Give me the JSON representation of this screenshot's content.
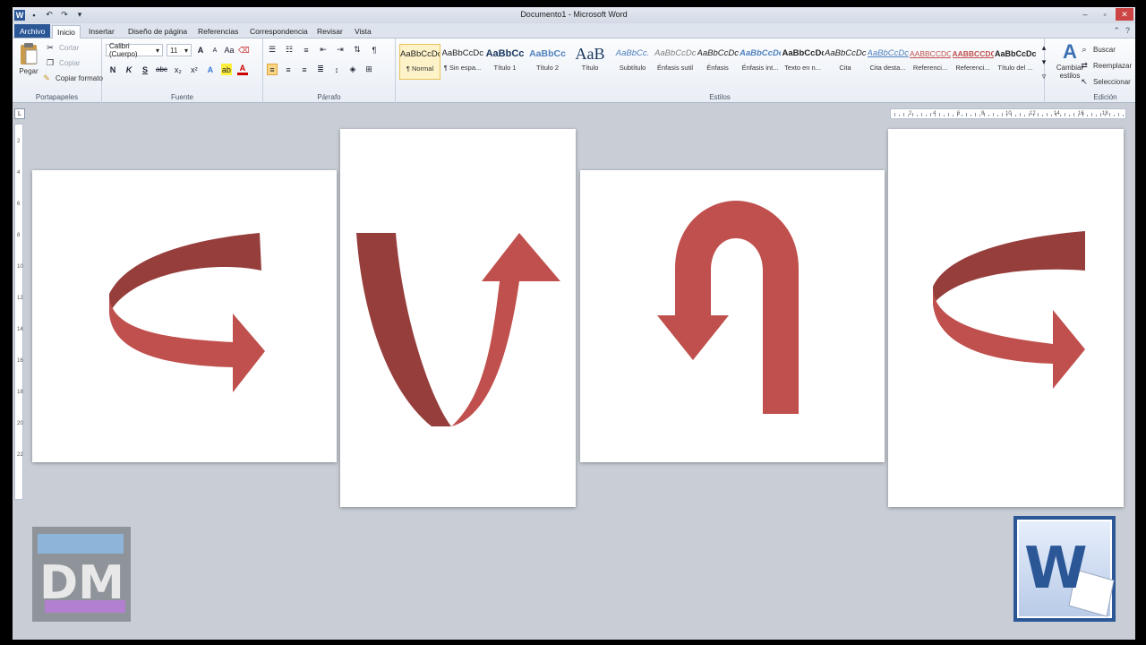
{
  "app": {
    "title": "Documento1 - Microsoft Word"
  },
  "tabs": [
    {
      "label": "Archivo"
    },
    {
      "label": "Inicio"
    },
    {
      "label": "Insertar"
    },
    {
      "label": "Diseño de página"
    },
    {
      "label": "Referencias"
    },
    {
      "label": "Correspondencia"
    },
    {
      "label": "Revisar"
    },
    {
      "label": "Vista"
    }
  ],
  "clipboard": {
    "paste": "Pegar",
    "cut": "Cortar",
    "copy": "Copiar",
    "format_painter": "Copiar formato",
    "group": "Portapapeles"
  },
  "font": {
    "family": "Calibri (Cuerpo)",
    "size": "11",
    "group": "Fuente",
    "bold": "N",
    "italic": "K",
    "underline": "S",
    "strike": "abc",
    "sub": "x₂",
    "sup": "x²",
    "grow": "A",
    "shrink": "A",
    "case": "Aa",
    "effects": "A",
    "highlight": "ab",
    "color": "A"
  },
  "paragraph": {
    "group": "Párrafo",
    "pilcrow": "¶"
  },
  "styles": {
    "group": "Estilos",
    "items": [
      {
        "sample": "AaBbCcDc",
        "name": "¶ Normal"
      },
      {
        "sample": "AaBbCcDc",
        "name": "¶ Sin espa..."
      },
      {
        "sample": "AaBbCc",
        "name": "Título 1"
      },
      {
        "sample": "AaBbCc",
        "name": "Título 2"
      },
      {
        "sample": "AaB",
        "name": "Título"
      },
      {
        "sample": "AaBbCc.",
        "name": "Subtítulo"
      },
      {
        "sample": "AaBbCcDc",
        "name": "Énfasis sutil"
      },
      {
        "sample": "AaBbCcDc",
        "name": "Énfasis"
      },
      {
        "sample": "AaBbCcDc",
        "name": "Énfasis int..."
      },
      {
        "sample": "AaBbCcDc",
        "name": "Texto en n..."
      },
      {
        "sample": "AaBbCcDc",
        "name": "Cita"
      },
      {
        "sample": "AaBbCcDc",
        "name": "Cita desta..."
      },
      {
        "sample": "AABBCCDC",
        "name": "Referenci..."
      },
      {
        "sample": "AABBCCDC",
        "name": "Referenci..."
      },
      {
        "sample": "AaBbCcDc",
        "name": "Título del ..."
      }
    ],
    "change": "Cambiar estilos"
  },
  "editing": {
    "group": "Edición",
    "find": "Buscar",
    "replace": "Reemplazar",
    "select": "Seleccionar"
  },
  "ruler": {
    "corner": "L",
    "numbers": [
      "2",
      "4",
      "6",
      "8",
      "10",
      "12",
      "14",
      "16",
      "18"
    ],
    "vnumbers": [
      "2",
      "4",
      "6",
      "8",
      "10",
      "12",
      "14",
      "16",
      "18",
      "20",
      "22"
    ]
  },
  "colors": {
    "arrow_dark": "#963e3c",
    "arrow_light": "#c0504d",
    "word_blue": "#2b5797"
  },
  "logos": {
    "dm": "DM",
    "word": "W"
  }
}
